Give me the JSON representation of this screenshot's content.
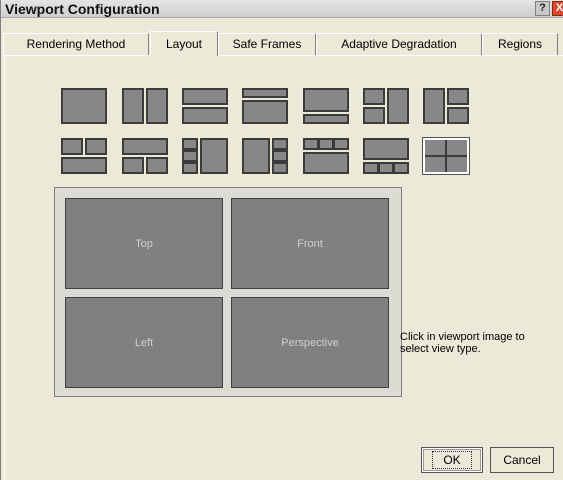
{
  "window": {
    "title": "Viewport Configuration",
    "help_label": "?",
    "close_label": "X"
  },
  "tabs": [
    {
      "label": "Rendering Method"
    },
    {
      "label": "Layout",
      "active": true
    },
    {
      "label": "Safe Frames"
    },
    {
      "label": "Adaptive Degradation"
    },
    {
      "label": "Regions"
    }
  ],
  "layouts": {
    "count": 14,
    "selected_index": 13
  },
  "preview": {
    "viewports": [
      {
        "label": "Top"
      },
      {
        "label": "Front"
      },
      {
        "label": "Left"
      },
      {
        "label": "Perspective"
      }
    ]
  },
  "hint": "Click in viewport image to select view type.",
  "buttons": {
    "ok": "OK",
    "cancel": "Cancel"
  }
}
